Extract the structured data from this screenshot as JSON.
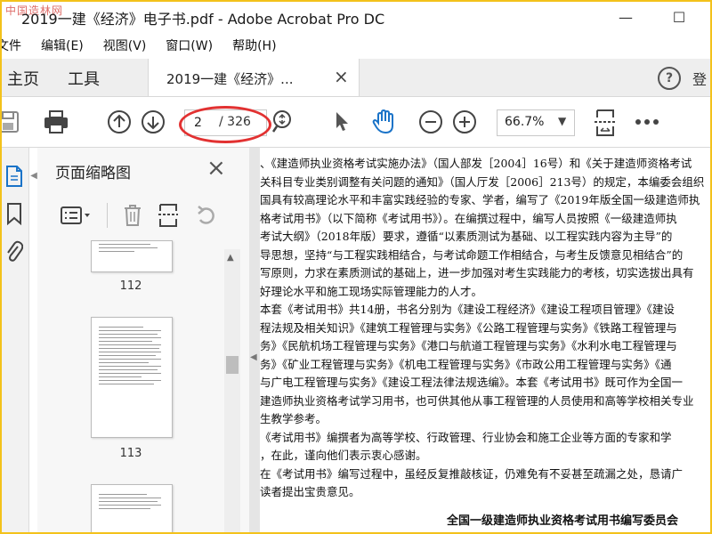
{
  "window": {
    "watermark": "中国造林网",
    "title": "2019一建《经济》电子书.pdf - Adobe Acrobat Pro DC",
    "minimize": "—",
    "maximize": "☐"
  },
  "menu": [
    "文件",
    "编辑(E)",
    "视图(V)",
    "窗口(W)",
    "帮助(H)"
  ],
  "tabs": {
    "home": "主页",
    "tools": "工具",
    "doc": "2019一建《经济》...",
    "close": "×",
    "help": "?",
    "right_cut": "登"
  },
  "toolbar": {
    "page_current": "2",
    "page_total": "/ 326",
    "zoom": "66.7%"
  },
  "thumbnails": {
    "title": "页面缩略图",
    "close": "×",
    "pages": [
      "112",
      "113"
    ]
  },
  "document": {
    "lines": [
      "、《建造师执业资格考试实施办法》（国人部发［2004］16号）和《关于建造师资格考试",
      "关科目专业类别调整有关问题的通知》（国人厅发［2006］213号）的规定，本编委会组织",
      "国具有较高理论水平和丰富实践经验的专家、学者，编写了《2019年版全国一级建造师执",
      "格考试用书》（以下简称《考试用书》）。在编撰过程中，编写人员按照《一级建造师执",
      "考试大纲》（2018年版）要求，遵循“以素质测试为基础、以工程实践内容为主导”的",
      "导思想，坚持“与工程实践相结合，与考试命题工作相结合，与考生反馈意见相结合”的",
      "写原则，力求在素质测试的基础上，进一步加强对考生实践能力的考核，切实选拔出具有",
      "好理论水平和施工现场实际管理能力的人才。",
      "   本套《考试用书》共14册，书名分别为《建设工程经济》《建设工程项目管理》《建设",
      "程法规及相关知识》《建筑工程管理与实务》《公路工程管理与实务》《铁路工程管理与",
      "务》《民航机场工程管理与实务》《港口与航道工程管理与实务》《水利水电工程管理与",
      "务》《矿业工程管理与实务》《机电工程管理与实务》《市政公用工程管理与实务》《通",
      "与广电工程管理与实务》《建设工程法律法规选编》。本套《考试用书》既可作为全国一",
      "建造师执业资格考试学习用书，也可供其他从事工程管理的人员使用和高等学校相关专业",
      "生教学参考。",
      "   《考试用书》编撰者为高等学校、行政管理、行业协会和施工企业等方面的专家和学",
      "，在此，谨向他们表示衷心感谢。",
      "   在《考试用书》编写过程中，虽经反复推敲核证，仍难免有不妥甚至疏漏之处，恳请广",
      "读者提出宝贵意见。"
    ],
    "signature": "全国一级建造师执业资格考试用书编写委员会"
  }
}
